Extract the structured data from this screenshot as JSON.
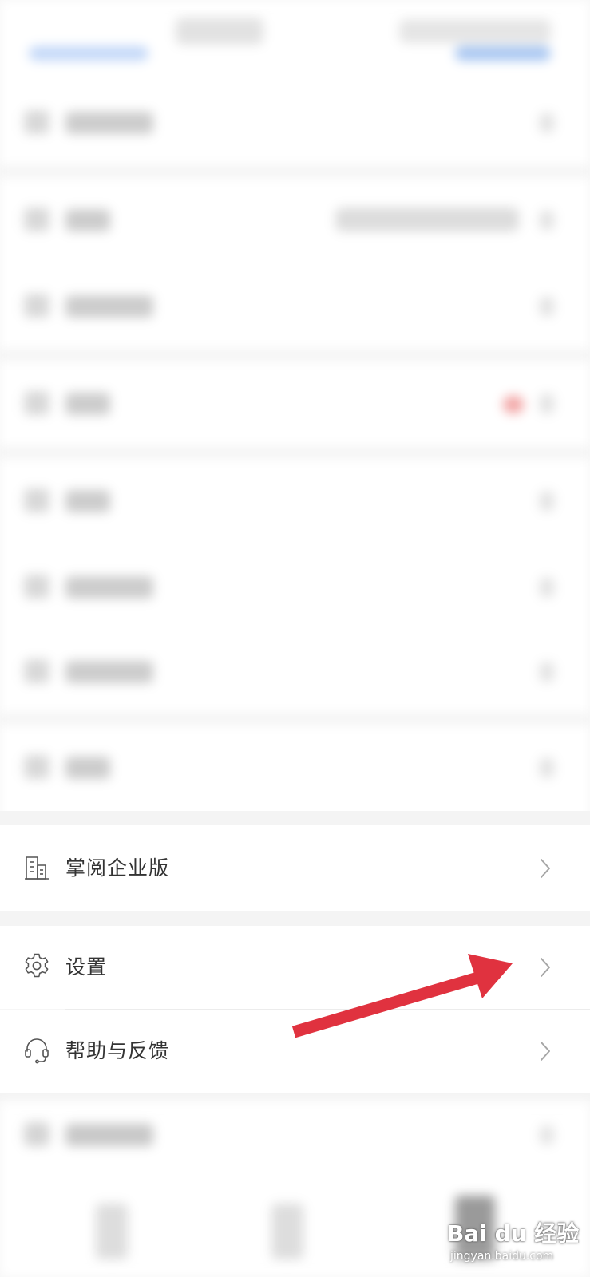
{
  "menu": {
    "items": [
      {
        "id": "enterprise",
        "label": "掌阅企业版",
        "icon": "building-icon"
      },
      {
        "id": "settings",
        "label": "设置",
        "icon": "gear-icon"
      },
      {
        "id": "help",
        "label": "帮助与反馈",
        "icon": "headset-icon"
      }
    ]
  },
  "colors": {
    "arrow": "#e0323f",
    "chevron": "#a6a6a6",
    "icon": "#555555",
    "text": "#333333",
    "background": "#f4f4f4"
  },
  "watermark": {
    "logo": "Bai du 经验",
    "sub": "jingyan.baidu.com"
  }
}
